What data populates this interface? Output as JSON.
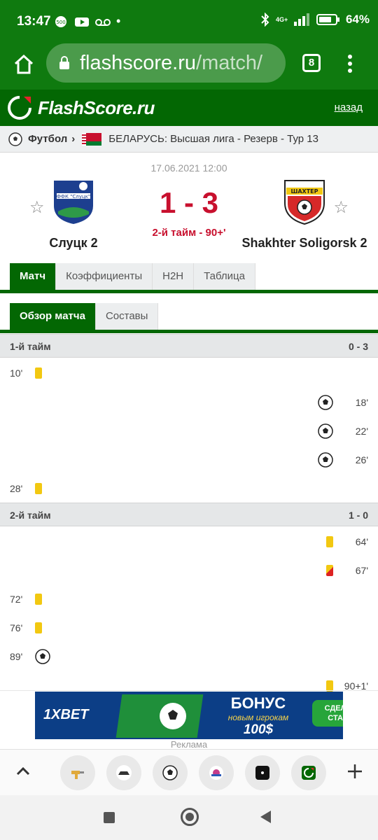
{
  "status_bar": {
    "time": "13:47",
    "battery": "64%",
    "network": "4G+"
  },
  "browser": {
    "url_host": "flashscore.ru",
    "url_path": "/match/",
    "tab_count": "8"
  },
  "site": {
    "logo_text": "FlashScore.ru",
    "back_link": "назад"
  },
  "breadcrumb": {
    "sport": "Футбол",
    "league": "БЕЛАРУСЬ: Высшая лига - Резерв - Тур 13"
  },
  "match": {
    "datetime": "17.06.2021 12:00",
    "home_team": "Слуцк 2",
    "away_team": "Shakhter Soligorsk 2",
    "score": "1 - 3",
    "status": "2-й тайм - 90+'",
    "home_crest_text": "ФФК \"Слуцк\"",
    "away_crest_text": "ШАХТЕР"
  },
  "tabs": [
    "Матч",
    "Коэффициенты",
    "H2H",
    "Таблица"
  ],
  "subtabs": [
    "Обзор матча",
    "Составы"
  ],
  "halves": [
    {
      "label": "1-й тайм",
      "score": "0 - 3",
      "events": [
        {
          "side": "home",
          "minute": "10'",
          "type": "yellow-card"
        },
        {
          "side": "away",
          "minute": "18'",
          "type": "goal"
        },
        {
          "side": "away",
          "minute": "22'",
          "type": "goal"
        },
        {
          "side": "away",
          "minute": "26'",
          "type": "goal"
        },
        {
          "side": "home",
          "minute": "28'",
          "type": "yellow-card"
        }
      ]
    },
    {
      "label": "2-й тайм",
      "score": "1 - 0",
      "events": [
        {
          "side": "away",
          "minute": "64'",
          "type": "yellow-card"
        },
        {
          "side": "away",
          "minute": "67'",
          "type": "yellow-red-card"
        },
        {
          "side": "home",
          "minute": "72'",
          "type": "yellow-card"
        },
        {
          "side": "home",
          "minute": "76'",
          "type": "yellow-card"
        },
        {
          "side": "home",
          "minute": "89'",
          "type": "goal"
        },
        {
          "side": "away",
          "minute": "90+1'",
          "type": "yellow-card"
        }
      ]
    }
  ],
  "ad": {
    "brand": "1XBET",
    "headline": "БОНУС",
    "subline": "новым игрокам",
    "amount": "100$",
    "cta": "СДЕЛАТЬ СТАВКУ",
    "label": "Реклама"
  },
  "colors": {
    "brand_green": "#0f7a0f",
    "dark_green": "#036703",
    "score_red": "#c8102e",
    "card_yellow": "#f2c811"
  }
}
